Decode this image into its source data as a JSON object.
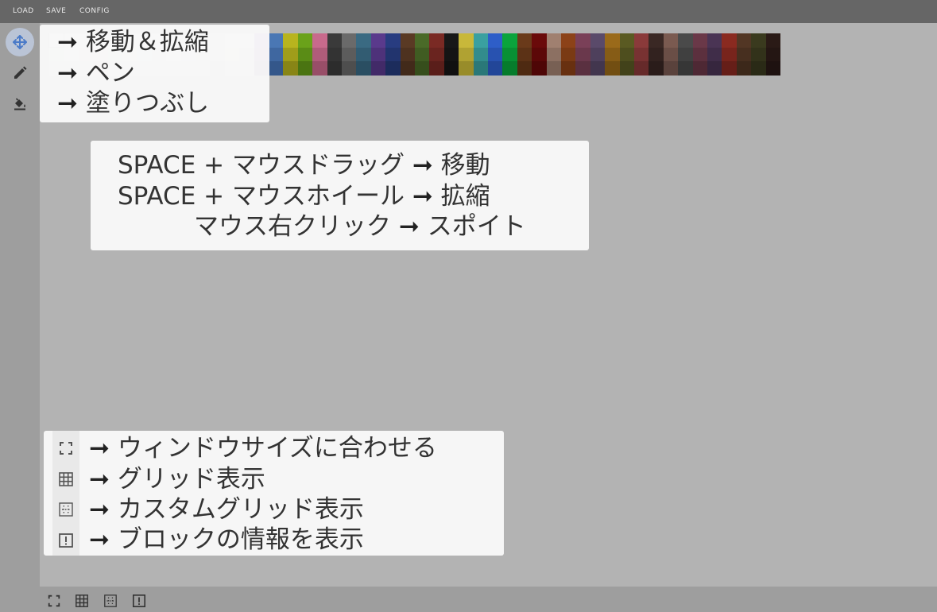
{
  "menu": {
    "load": "LOAD",
    "save": "SAVE",
    "config": "CONFIG"
  },
  "toolbar": {
    "tools": [
      {
        "name": "move-zoom",
        "icon": "move-arrows-icon",
        "active": true
      },
      {
        "name": "pen",
        "icon": "pencil-icon",
        "active": false
      },
      {
        "name": "fill",
        "icon": "paint-bucket-icon",
        "active": false
      }
    ],
    "accent": "#4a7ac8"
  },
  "help_tools": {
    "arrow": "➞",
    "lines": [
      "移動＆拡縮",
      "ペン",
      "塗りつぶし"
    ]
  },
  "help_mouse": {
    "lines": [
      {
        "left": "SPACE + マウスドラッグ",
        "arrow": "➞",
        "right": "移動"
      },
      {
        "left": "SPACE + マウスホイール",
        "arrow": "➞",
        "right": "拡縮"
      },
      {
        "left": "マウス右クリック",
        "arrow": "➞",
        "right": "スポイト"
      }
    ]
  },
  "help_view": {
    "arrow": "➞",
    "lines": [
      "ウィンドウサイズに合わせる",
      "グリッド表示",
      "カスタムグリッド表示",
      "ブロックの情報を表示"
    ],
    "icons": [
      "fit-window-icon",
      "grid-icon",
      "custom-grid-icon",
      "block-info-icon"
    ]
  },
  "bottom_icons": [
    "fit-window-icon",
    "grid-icon",
    "custom-grid-icon",
    "block-info-icon"
  ],
  "palette": [
    [
      "#e8efe4",
      "#dce8d4",
      "#d0dcc8"
    ],
    [
      "#f2f2ec",
      "#ebebe4",
      "#e0e0d8"
    ],
    [
      "#f0ece8",
      "#e8e2dc",
      "#dcd6d0"
    ],
    [
      "#f4e4e4",
      "#ecd4d4",
      "#e2c6c6"
    ],
    [
      "#eef2ea",
      "#e2eadc",
      "#d6e0cf"
    ],
    [
      "#f0f4ee",
      "#e4ebe0",
      "#d8e0d4"
    ],
    [
      "#e6eef2",
      "#dae6ec",
      "#ccdae2"
    ],
    [
      "#ecedee",
      "#e0e1e2",
      "#d4d5d6"
    ],
    [
      "#f2f2f2",
      "#e6e6e6",
      "#dadada"
    ],
    [
      "#eaeaf2",
      "#dedeea",
      "#d2d2e0"
    ],
    [
      "#ebebeb",
      "#dedede",
      "#d2d2d2"
    ],
    [
      "#dcdcdc",
      "#d0d0d0",
      "#c4c4c4"
    ],
    [
      "#f4f0ec",
      "#ebe6e0",
      "#e0dad4"
    ],
    [
      "#eeeaea",
      "#e2dede",
      "#d6d2d2"
    ],
    [
      "#8c4fb6",
      "#7a45a0",
      "#66398a"
    ],
    [
      "#4a77b4",
      "#3f67a0",
      "#34578a"
    ],
    [
      "#b8b41e",
      "#a09d1a",
      "#888516"
    ],
    [
      "#6aa21a",
      "#5a8c16",
      "#4a7412"
    ],
    [
      "#c86a8c",
      "#b05c7a",
      "#984e68"
    ],
    [
      "#3a3a3a",
      "#333333",
      "#2c2c2c"
    ],
    [
      "#6a6a6a",
      "#5c5c5c",
      "#4e4e4e"
    ],
    [
      "#3a6a82",
      "#325c72",
      "#2a4e62"
    ],
    [
      "#5a3a8c",
      "#4e327a",
      "#422a68"
    ],
    [
      "#283c80",
      "#22346e",
      "#1c2c5c"
    ],
    [
      "#5a3a24",
      "#4e321f",
      "#422a1a"
    ],
    [
      "#4a6a28",
      "#405c22",
      "#364e1c"
    ],
    [
      "#7a2a24",
      "#6a241f",
      "#5a1e1a"
    ],
    [
      "#181818",
      "#141414",
      "#101010"
    ],
    [
      "#c8b83a",
      "#b0a232",
      "#988c2a"
    ],
    [
      "#3aa0a0",
      "#328c8c",
      "#2a7878"
    ],
    [
      "#2e5ec8",
      "#2852b0",
      "#224698"
    ],
    [
      "#0aa43c",
      "#089034",
      "#067c2c"
    ],
    [
      "#6a3a1a",
      "#5c3216",
      "#4e2a12"
    ],
    [
      "#6a0a0a",
      "#5c0808",
      "#4e0606"
    ],
    [
      "#a08070",
      "#8c7062",
      "#786054"
    ],
    [
      "#8c4218",
      "#7a3a14",
      "#683010"
    ],
    [
      "#7a4058",
      "#6a384c",
      "#5a3040"
    ],
    [
      "#5a4a6a",
      "#4e405c",
      "#42364e"
    ],
    [
      "#9a6a1a",
      "#865c16",
      "#724e12"
    ],
    [
      "#5a5a22",
      "#4e4e1e",
      "#42421a"
    ],
    [
      "#8a3a3a",
      "#783232",
      "#662a2a"
    ],
    [
      "#3a2824",
      "#32221f",
      "#2a1c1a"
    ],
    [
      "#7a5a50",
      "#6a4e46",
      "#5a423c"
    ],
    [
      "#4a4a4a",
      "#404040",
      "#363636"
    ],
    [
      "#6a3848",
      "#5c303e",
      "#4e2834"
    ],
    [
      "#4a3454",
      "#402d49",
      "#36263e"
    ],
    [
      "#8a2a20",
      "#78241c",
      "#661e18"
    ],
    [
      "#523624",
      "#472f1f",
      "#3c281a"
    ],
    [
      "#3a3a1e",
      "#32321a",
      "#2a2a16"
    ],
    [
      "#2a1a16",
      "#241613",
      "#1e1210"
    ]
  ]
}
